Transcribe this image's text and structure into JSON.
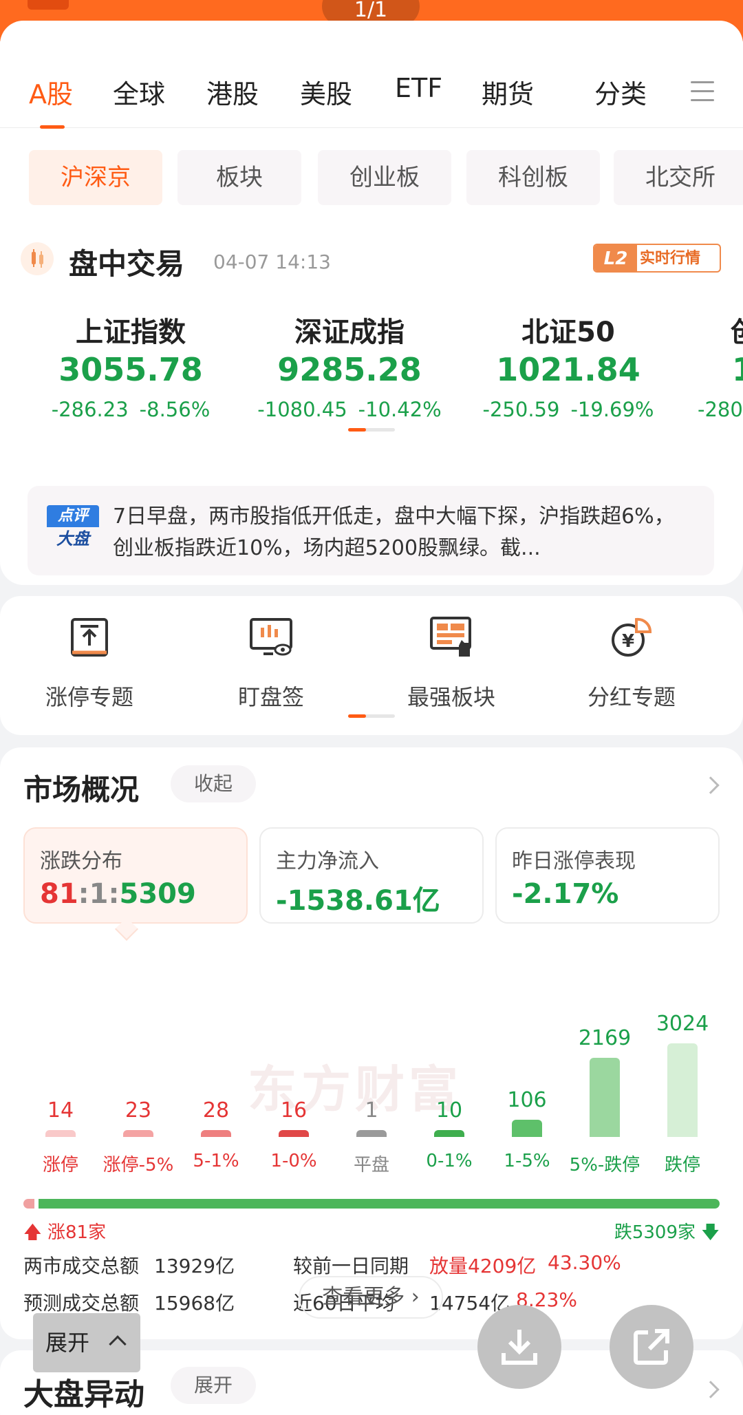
{
  "topbar": {
    "page_indicator": "1/1"
  },
  "tabs": [
    "A股",
    "全球",
    "港股",
    "美股",
    "ETF",
    "期货",
    "分类"
  ],
  "chips": [
    "沪深京",
    "板块",
    "创业板",
    "科创板",
    "北交所"
  ],
  "intraday": {
    "title": "盘中交易",
    "time": "04-07 14:13",
    "badge_l2": "L2",
    "badge_text": "实时行情"
  },
  "indices": [
    {
      "name": "上证指数",
      "value": "3055.78",
      "change": "-286.23",
      "pct": "-8.56%"
    },
    {
      "name": "深证成指",
      "value": "9285.28",
      "change": "-1080.45",
      "pct": "-10.42%"
    },
    {
      "name": "北证50",
      "value": "1021.84",
      "change": "-250.59",
      "pct": "-19.69%"
    },
    {
      "name": "创",
      "value": "1",
      "change": "-280",
      "pct": ""
    }
  ],
  "commentary": {
    "badge_top": "点评",
    "badge_bottom": "大盘",
    "text": "7日早盘，两市股指低开低走，盘中大幅下探，沪指跌超6%，创业板指跌近10%，场内超5200股飘绿。截..."
  },
  "tools": [
    "涨停专题",
    "盯盘签",
    "最强板块",
    "分红专题"
  ],
  "market": {
    "title": "市场概况",
    "collapse": "收起",
    "stats": [
      {
        "label": "涨跌分布",
        "value_up": "81",
        "value_sep1": ":",
        "value_flat": "1",
        "value_sep2": ":",
        "value_down": "5309"
      },
      {
        "label": "主力净流入",
        "value": "-1538.61亿"
      },
      {
        "label": "昨日涨停表现",
        "value": "-2.17%"
      }
    ],
    "watermark": "东方财富",
    "ratio_up_label": "涨81家",
    "ratio_down_label": "跌5309家",
    "turnover": {
      "total_label": "两市成交总额",
      "total_value": "13929亿",
      "compare_label": "较前一日同期",
      "compare_value": "放量4209亿",
      "compare_pct": "43.30%",
      "forecast_label": "预测成交总额",
      "forecast_value": "15968亿",
      "avg_label": "近60日平均",
      "avg_value": "14754亿",
      "avg_pct": "8.23%"
    },
    "more": "查看更多"
  },
  "chart_data": {
    "type": "bar",
    "categories": [
      "涨停",
      "涨停-5%",
      "5-1%",
      "1-0%",
      "平盘",
      "0-1%",
      "1-5%",
      "5%-跌停",
      "跌停"
    ],
    "values": [
      14,
      23,
      28,
      16,
      1,
      10,
      106,
      2169,
      3024
    ],
    "colors": [
      "#f9c9c9",
      "#f4a3a3",
      "#ee7f7f",
      "#e04848",
      "#9a9a9a",
      "#3fae4e",
      "#5ec06a",
      "#9bd79f",
      "#d6efd6"
    ],
    "label_colors": [
      "#e53535",
      "#e53535",
      "#e53535",
      "#e53535",
      "#888888",
      "#1ba04a",
      "#1ba04a",
      "#1ba04a",
      "#1ba04a"
    ]
  },
  "ratio": {
    "up": 81,
    "flat": 1,
    "down": 5309
  },
  "bottom": {
    "title": "大盘异动",
    "expand": "展开"
  },
  "float": {
    "expand": "展开"
  }
}
